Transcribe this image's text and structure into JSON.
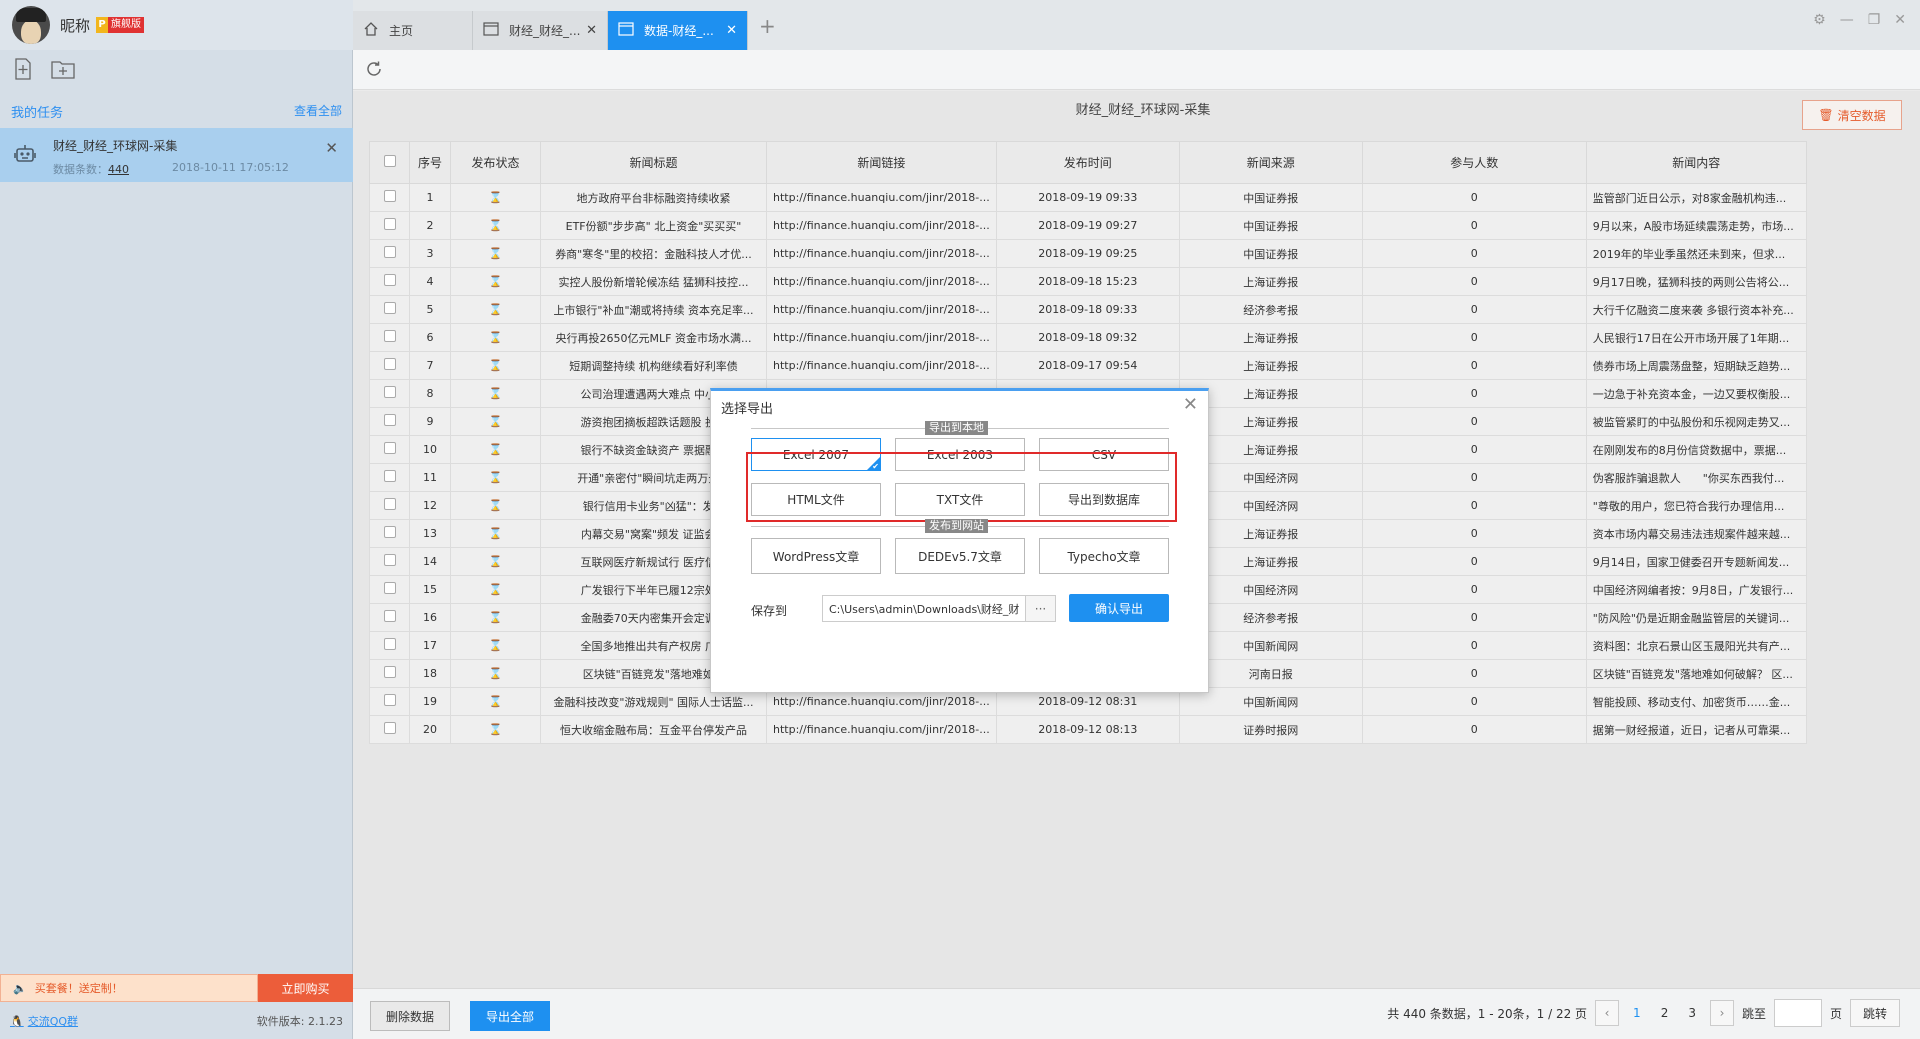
{
  "user": {
    "nickname": "昵称",
    "vip_p": "P",
    "vip_text": "旗舰版"
  },
  "sidebar": {
    "my_tasks": "我的任务",
    "view_all": "查看全部",
    "task": {
      "name": "财经_财经_环球网-采集",
      "count_label": "数据条数：",
      "count": "440",
      "date": "2018-10-11 17:05:12"
    },
    "promo_text": "买套餐！送定制！",
    "promo_buy": "立即购买",
    "qq_group": "交流QQ群",
    "version": "软件版本: 2.1.23"
  },
  "tabs": [
    {
      "label": "主页"
    },
    {
      "label": "财经_财经_..."
    },
    {
      "label": "数据-财经_..."
    }
  ],
  "page": {
    "title": "财经_财经_环球网-采集",
    "clear_btn": "清空数据"
  },
  "table": {
    "headers": [
      "序号",
      "发布状态",
      "新闻标题",
      "新闻链接",
      "发布时间",
      "新闻来源",
      "参与人数",
      "新闻内容"
    ],
    "rows": [
      [
        "1",
        "地方政府平台非标融资持续收紧",
        "http://finance.huanqiu.com/jinr/2018-...",
        "2018-09-19 09:33",
        "中国证券报",
        "0",
        "监管部门近日公示，对8家金融机构违..."
      ],
      [
        "2",
        "ETF份额\"步步高\" 北上资金\"买买买\"",
        "http://finance.huanqiu.com/jinr/2018-...",
        "2018-09-19 09:27",
        "中国证券报",
        "0",
        "9月以来，A股市场延续震荡走势，市场..."
      ],
      [
        "3",
        "券商\"寒冬\"里的校招：金融科技人才优...",
        "http://finance.huanqiu.com/jinr/2018-...",
        "2018-09-19 09:25",
        "中国证券报",
        "0",
        "2019年的毕业季虽然还未到来，但求..."
      ],
      [
        "4",
        "实控人股份新增轮候冻结 猛狮科技控...",
        "http://finance.huanqiu.com/jinr/2018-...",
        "2018-09-18 15:23",
        "上海证券报",
        "0",
        "9月17日晚，猛狮科技的两则公告将公..."
      ],
      [
        "5",
        "上市银行\"补血\"潮或将持续 资本充足率...",
        "http://finance.huanqiu.com/jinr/2018-...",
        "2018-09-18 09:33",
        "经济参考报",
        "0",
        "大行千亿融资二度来袭 多银行资本补充..."
      ],
      [
        "6",
        "央行再投2650亿元MLF 资金市场水满...",
        "http://finance.huanqiu.com/jinr/2018-...",
        "2018-09-18 09:32",
        "上海证券报",
        "0",
        "人民银行17日在公开市场开展了1年期..."
      ],
      [
        "7",
        "短期调整持续 机构继续看好利率债",
        "http://finance.huanqiu.com/jinr/2018-...",
        "2018-09-17 09:54",
        "上海证券报",
        "0",
        "债券市场上周震荡盘整，短期缺乏趋势..."
      ],
      [
        "8",
        "公司治理遭遇两大难点 中小...",
        "",
        "",
        "上海证券报",
        "0",
        "一边急于补充资本金，一边又要权衡股..."
      ],
      [
        "9",
        "游资抱团摘板超跌话题股 投...",
        "",
        "",
        "上海证券报",
        "0",
        "被监管紧盯的中弘股份和乐视网走势又..."
      ],
      [
        "10",
        "银行不缺资金缺资产 票据融...",
        "",
        "",
        "上海证券报",
        "0",
        "在刚刚发布的8月份信贷数据中，票据..."
      ],
      [
        "11",
        "开通\"亲密付\"瞬间坑走两万元...",
        "",
        "",
        "中国经济网",
        "0",
        "伪客服詐骗退款人　　\"你买东西我付..."
      ],
      [
        "12",
        "银行信用卡业务\"凶猛\"：发...",
        "",
        "",
        "中国经济网",
        "0",
        "\"尊敬的用户，您已符合我行办理信用..."
      ],
      [
        "13",
        "内幕交易\"窝案\"频发 证监会...",
        "",
        "",
        "上海证券报",
        "0",
        "资本市场内幕交易违法违规案件越来越..."
      ],
      [
        "14",
        "互联网医疗新规试行 医疗信...",
        "",
        "",
        "上海证券报",
        "0",
        "9月14日，国家卫健委召开专题新闻发..."
      ],
      [
        "15",
        "广发银行下半年已履12宗处...",
        "",
        "",
        "中国经济网",
        "0",
        "中国经济网编者按：9月8日，广发银行..."
      ],
      [
        "16",
        "金融委70天内密集开会定调...",
        "",
        "",
        "经济参考报",
        "0",
        "\"防风险\"仍是近期金融监管层的关键词..."
      ],
      [
        "17",
        "全国多地推出共有产权房 广...",
        "",
        "",
        "中国新闻网",
        "0",
        "资料图：北京石景山区玉晟阳光共有产..."
      ],
      [
        "18",
        "区块链\"百链竞发\"落地难如...",
        "",
        "",
        "河南日报",
        "0",
        "区块链\"百链竞发\"落地难如何破解？ 区..."
      ],
      [
        "19",
        "金融科技改变\"游戏规则\" 国际人士话监...",
        "http://finance.huanqiu.com/jinr/2018-...",
        "2018-09-12 08:31",
        "中国新闻网",
        "0",
        "智能投顾、移动支付、加密货币……金..."
      ],
      [
        "20",
        "恒大收缩金融布局：互金平台停发产品",
        "http://finance.huanqiu.com/jinr/2018-...",
        "2018-09-12 08:13",
        "证券时报网",
        "0",
        "据第一财经报道，近日，记者从可靠渠..."
      ]
    ]
  },
  "dialog": {
    "title": "选择导出",
    "section_local": "导出到本地",
    "local_options": [
      "Excel 2007",
      "Excel 2003",
      "CSV",
      "HTML文件",
      "TXT文件",
      "导出到数据库"
    ],
    "section_site": "发布到网站",
    "site_options": [
      "WordPress文章",
      "DEDEv5.7文章",
      "Typecho文章"
    ],
    "save_label": "保存到",
    "save_path": "C:\\Users\\admin\\Downloads\\财经_财",
    "browse": "···",
    "confirm": "确认导出"
  },
  "bottom": {
    "delete_btn": "删除数据",
    "export_all_btn": "导出全部",
    "summary": "共 440 条数据，1 - 20条，1 / 22 页",
    "pages": [
      "1",
      "2",
      "3"
    ],
    "goto_label": "跳至",
    "page_unit": "页",
    "jump_btn": "跳转"
  },
  "colors": {
    "accent": "#1e90f0",
    "highlight_box": "#e02a2a",
    "promo": "#ec5d3a"
  }
}
